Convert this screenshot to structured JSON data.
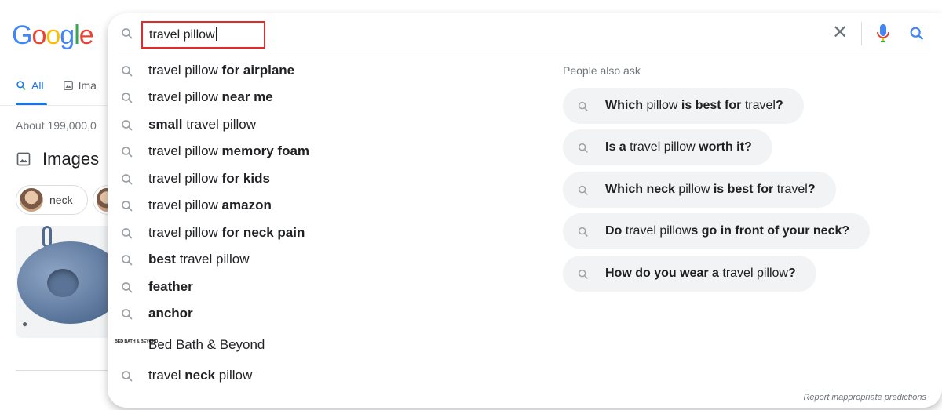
{
  "logo": {
    "letters": [
      "G",
      "o",
      "o",
      "g",
      "l",
      "e"
    ]
  },
  "tabs": {
    "all": "All",
    "images": "Ima"
  },
  "result_stats": "About 199,000,0",
  "images_section": {
    "heading": "Images",
    "chip_label": "neck"
  },
  "search": {
    "query": "travel pillow",
    "clear_symbol": "✕"
  },
  "suggestions": [
    {
      "plain": "travel pillow ",
      "bold": "for airplane",
      "bold_first": false
    },
    {
      "plain": "travel pillow ",
      "bold": "near me",
      "bold_first": false
    },
    {
      "bold": "small",
      "plain": " travel pillow",
      "bold_first": true
    },
    {
      "plain": "travel pillow ",
      "bold": "memory foam",
      "bold_first": false
    },
    {
      "plain": "travel pillow ",
      "bold": "for kids",
      "bold_first": false
    },
    {
      "plain": "travel pillow ",
      "bold": "amazon",
      "bold_first": false
    },
    {
      "plain": "travel pillow ",
      "bold": "for neck pain",
      "bold_first": false
    },
    {
      "bold": "best",
      "plain": " travel pillow",
      "bold_first": true
    },
    {
      "bold": "feather",
      "plain": "",
      "bold_first": true
    },
    {
      "bold": "anchor",
      "plain": "",
      "bold_first": true
    }
  ],
  "entity_suggestion": {
    "label": "Bed Bath & Beyond",
    "logo_text": "BED BATH & BEYOND"
  },
  "last_suggestion": {
    "p1": "travel ",
    "b1": "neck",
    "p2": " pillow"
  },
  "people_also_ask": {
    "title": "People also ask",
    "questions": [
      {
        "b1": "Which",
        "p1": " pillow ",
        "b2": "is best for",
        "p2": " travel",
        "b3": "?"
      },
      {
        "b1": "Is a",
        "p1": " travel pillow ",
        "b2": "worth it?",
        "p2": "",
        "b3": ""
      },
      {
        "b1": "Which neck",
        "p1": " pillow ",
        "b2": "is best for",
        "p2": " travel",
        "b3": "?"
      },
      {
        "b1": "Do",
        "p1": " travel pillow",
        "b2": "s go in front of your neck?",
        "p2": "",
        "b3": ""
      },
      {
        "b1": "How do you wear a",
        "p1": " travel pillow",
        "b2": "?",
        "p2": "",
        "b3": ""
      }
    ]
  },
  "footer": {
    "report": "Report inappropriate predictions"
  },
  "colors": {
    "accent": "#1a73e8",
    "highlight_box": "#e52a2a",
    "chip_bg": "#f1f3f4"
  }
}
